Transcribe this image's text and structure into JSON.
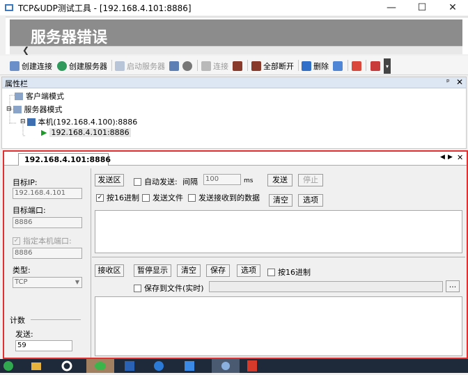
{
  "window": {
    "title": "TCP&UDP测试工具 - [192.168.4.101:8886]",
    "minimize": "—",
    "maximize": "☐",
    "close": "✕"
  },
  "banner": {
    "error_text": "服务器错误"
  },
  "toolbar": {
    "create_connection": "创建连接",
    "create_server": "创建服务器",
    "start_server": "启动服务器",
    "connect": "连接",
    "disconnect_all": "全部断开",
    "delete": "删除"
  },
  "properties": {
    "title": "属性栏",
    "tree": {
      "client_mode": "客户端模式",
      "server_mode": "服务器模式",
      "local": "本机(192.168.4.100):8886",
      "remote": "192.168.4.101:8886"
    }
  },
  "session": {
    "tab_label": "192.168.4.101:8886",
    "target_ip_label": "目标IP:",
    "target_ip_value": "192.168.4.101",
    "target_port_label": "目标端口:",
    "target_port_value": "8886",
    "local_port_check": "指定本机端口:",
    "local_port_value": "8886",
    "type_label": "类型:",
    "type_value": "TCP",
    "count_label": "计数",
    "send_count_label": "发送:",
    "send_count_value": "59",
    "send_area": {
      "area_label": "发送区",
      "auto_send": "自动发送:",
      "interval_label": "间隔",
      "interval_value": "100",
      "ms": "ms",
      "send_btn": "发送",
      "stop_btn": "停止",
      "hex_check": "按16进制",
      "send_file": "发送文件",
      "send_received": "发送接收到的数据",
      "clear_btn": "清空",
      "options_btn": "选项"
    },
    "recv_area": {
      "area_label": "接收区",
      "pause_btn": "暂停显示",
      "clear_btn": "清空",
      "save_btn": "保存",
      "options_btn": "选项",
      "hex_check": "按16进制",
      "save_to_file": "保存到文件(实时)",
      "browse_btn": "..."
    }
  },
  "colors": {
    "highlight_border": "#e03030",
    "panel_header": "#dde6f3",
    "banner_bg": "#8c8c8c"
  }
}
